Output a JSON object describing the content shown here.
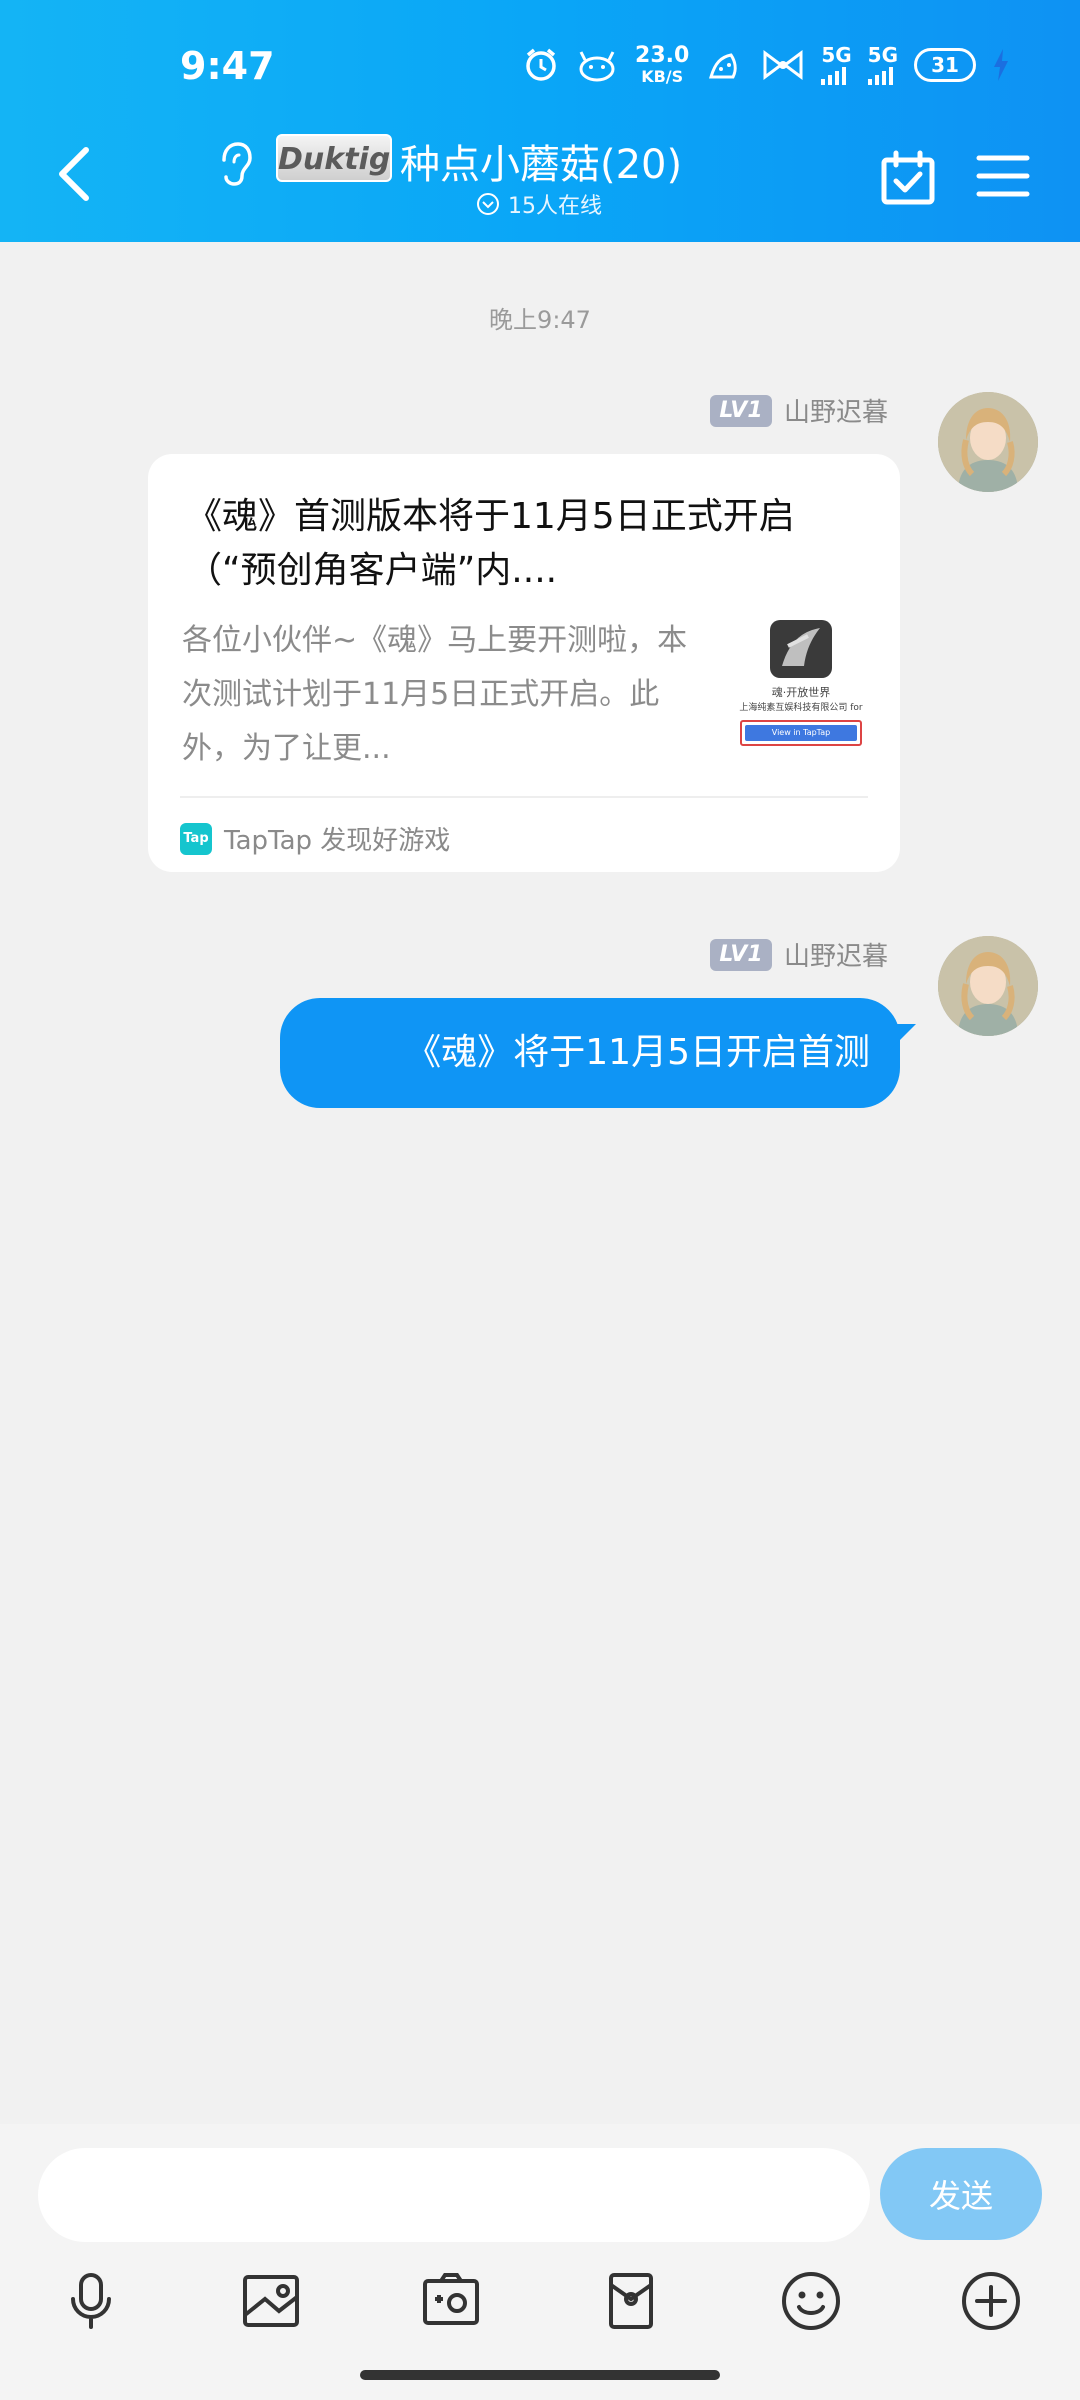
{
  "status_bar": {
    "time": "9:47",
    "net_speed_value": "23.0",
    "net_speed_unit": "KB/S",
    "sim1": "5G",
    "sim2": "5G",
    "battery": "31",
    "icons": [
      "alarm-icon",
      "pet-icon",
      "sim-icon",
      "bow-icon",
      "signal-icon",
      "battery-icon",
      "charging-icon"
    ]
  },
  "header": {
    "group_logo": "Duktig",
    "group_name": "种点小蘑菇(20)",
    "online": "15人在线"
  },
  "chat": {
    "timestamp": "晚上9:47",
    "messages": [
      {
        "lv": "LV1",
        "sender": "山野迟暮",
        "card": {
          "title": "《魂》首测版本将于11月5日正式开启（“预创角客户端”内....",
          "desc": "各位小伙伴~《魂》马上要开测啦，本次测试计划于11月5日正式开启。此外，为了让更...",
          "thumb_caption_1": "魂·开放世界",
          "thumb_caption_2": "上海纯素互娱科技有限公司 for",
          "thumb_button": "View in TapTap",
          "source_logo": "Tap",
          "source": "TapTap 发现好游戏"
        }
      },
      {
        "lv": "LV1",
        "sender": "山野迟暮",
        "text": "《魂》将于11月5日开启首测"
      }
    ]
  },
  "input": {
    "value": "",
    "send_label": "发送"
  },
  "colors": {
    "header": "#0aa6f7",
    "bubble": "#0f95f5",
    "send_button": "#82c8f5",
    "background": "#f1f1f1"
  }
}
